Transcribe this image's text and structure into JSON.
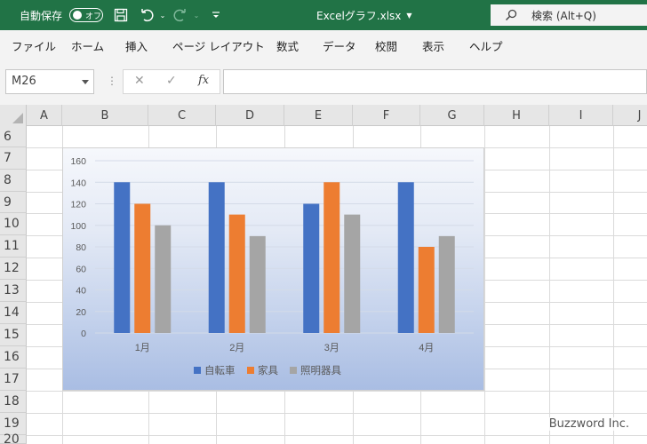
{
  "titlebar": {
    "autosave_label": "自動保存",
    "autosave_state": "オフ",
    "filename": "Excelグラフ.xlsx",
    "search_label": "検索 (Alt+Q)"
  },
  "menu": [
    "ファイル",
    "ホーム",
    "挿入",
    "ページ レイアウト",
    "数式",
    "データ",
    "校閲",
    "表示",
    "ヘルプ"
  ],
  "formula_bar": {
    "name_box": "M26",
    "cancel": "✕",
    "enter": "✓",
    "fx": "fx",
    "formula": ""
  },
  "columns": [
    "A",
    "B",
    "C",
    "D",
    "E",
    "F",
    "G",
    "H",
    "I",
    "J"
  ],
  "rows": [
    "6",
    "7",
    "8",
    "9",
    "10",
    "11",
    "12",
    "13",
    "14",
    "15",
    "16",
    "17",
    "18",
    "19",
    "20"
  ],
  "watermark": "Buzzword Inc.",
  "colors": {
    "title_bar": "#217346",
    "series_1": "#4472C4",
    "series_2": "#ED7D31",
    "series_3": "#A5A5A5"
  },
  "chart_data": {
    "type": "bar",
    "categories": [
      "1月",
      "2月",
      "3月",
      "4月"
    ],
    "series": [
      {
        "name": "自転車",
        "values": [
          140,
          140,
          120,
          140
        ]
      },
      {
        "name": "家具",
        "values": [
          120,
          110,
          140,
          80
        ]
      },
      {
        "name": "照明器具",
        "values": [
          100,
          90,
          110,
          90
        ]
      }
    ],
    "ylim": [
      0,
      160
    ],
    "yticks": [
      "0",
      "20",
      "40",
      "60",
      "80",
      "100",
      "120",
      "140",
      "160"
    ],
    "grid": true,
    "legend": "bottom"
  }
}
